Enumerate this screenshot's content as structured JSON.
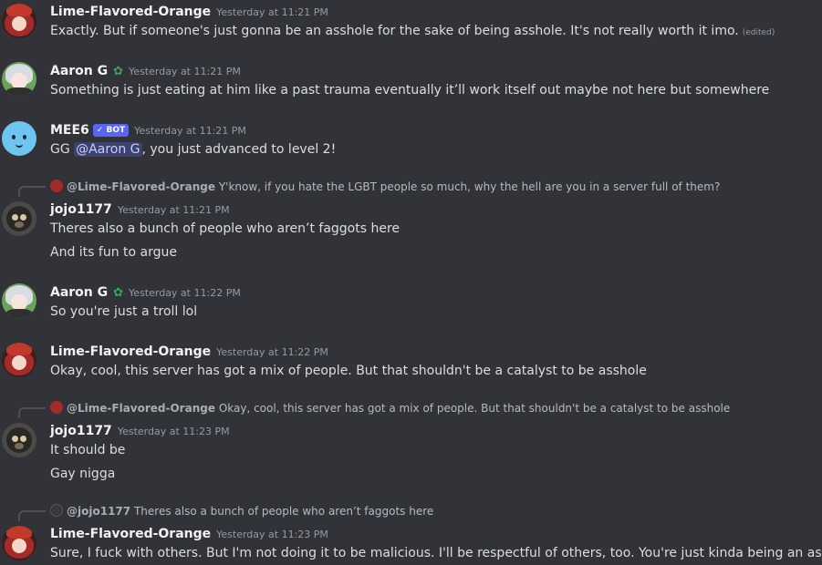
{
  "messages": [
    {
      "author": "Lime-Flavored-Orange",
      "timestamp": "Yesterday at 11:21 PM",
      "lines": [
        "Exactly. But if someone's just gonna be an asshole for the sake of being asshole. It's not really worth it imo."
      ],
      "edited": "(edited)"
    },
    {
      "author": "Aaron G",
      "timestamp": "Yesterday at 11:21 PM",
      "lines": [
        "Something is just eating at him like a past trauma eventually it’ll work itself out maybe not here but somewhere"
      ]
    },
    {
      "author": "MEE6",
      "badge": "✓ BOT",
      "timestamp": "Yesterday at 11:21 PM",
      "text_pre": "GG ",
      "mention": "@Aaron G",
      "text_post": ", you just advanced to level 2!"
    },
    {
      "reply_to": "@Lime-Flavored-Orange",
      "reply_text": "Y'know, if you hate the LGBT people so much, why the hell are you in a server full of them?",
      "author": "jojo1177",
      "timestamp": "Yesterday at 11:21 PM",
      "lines": [
        "Theres also a bunch of people who aren’t faggots here",
        "And its fun to argue"
      ]
    },
    {
      "author": "Aaron G",
      "timestamp": "Yesterday at 11:22 PM",
      "lines": [
        "So you're just a troll lol"
      ]
    },
    {
      "author": "Lime-Flavored-Orange",
      "timestamp": "Yesterday at 11:22 PM",
      "lines": [
        "Okay, cool, this server has got a mix of people. But that shouldn't be a catalyst to be asshole"
      ]
    },
    {
      "reply_to": "@Lime-Flavored-Orange",
      "reply_text": "Okay, cool, this server has got a mix of people. But that shouldn't be a catalyst to be asshole",
      "author": "jojo1177",
      "timestamp": "Yesterday at 11:23 PM",
      "lines": [
        "It should be",
        "Gay nigga"
      ]
    },
    {
      "reply_to": "@jojo1177",
      "reply_text": "Theres also a bunch of people who aren’t faggots here",
      "author": "Lime-Flavored-Orange",
      "timestamp": "Yesterday at 11:23 PM",
      "lines": [
        "Sure, I fuck with others. But I'm not doing it to be malicious. I'll be respectful of others, too. You're just kinda being an asshole"
      ]
    }
  ],
  "colors": {
    "background": "#313338",
    "username": "#f2f3f5",
    "text": "#dbdee1",
    "timestamp": "#949ba4",
    "bot_badge": "#5865f2",
    "mention_bg": "#3c4270",
    "leaf_icon": "#3ba55c"
  },
  "icons": {
    "leaf": "sprout-icon",
    "bot_check": "check-icon"
  }
}
